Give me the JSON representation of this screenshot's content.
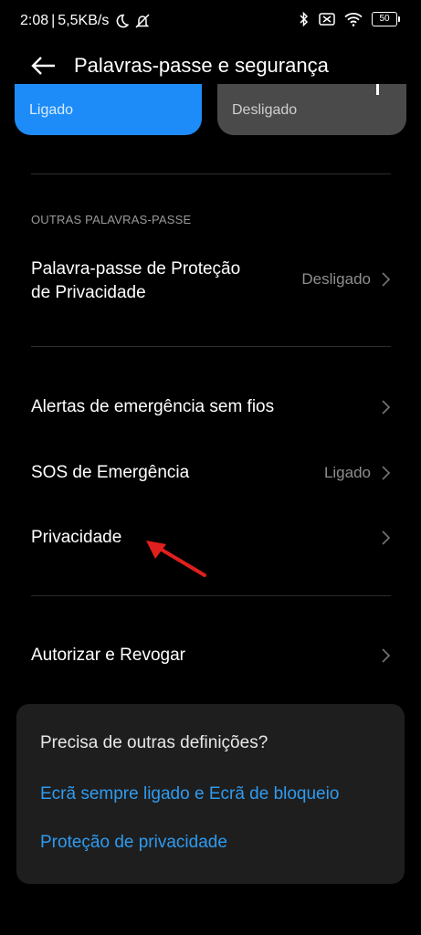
{
  "status_bar": {
    "time": "2:08",
    "separator": "|",
    "speed": "5,5KB/s",
    "battery": "50",
    "icons": [
      "moon-icon",
      "bell-off-icon",
      "bluetooth-icon",
      "screen-icon",
      "wifi-icon",
      "battery-icon"
    ]
  },
  "header": {
    "title": "Palavras-passe e segurança",
    "back_icon": "arrow-left-icon"
  },
  "modes": {
    "on_label": "Ligado",
    "off_label": "Desligado"
  },
  "section": {
    "header": "OUTRAS PALAVRAS-PASSE"
  },
  "rows": {
    "privacy_password": {
      "title_line1": "Palavra-passe de Proteção",
      "title_line2": "de Privacidade",
      "value": "Desligado"
    },
    "emergency_alerts": {
      "title": "Alertas de emergência sem fios"
    },
    "sos": {
      "title": "SOS de Emergência",
      "value": "Ligado"
    },
    "privacy": {
      "title": "Privacidade"
    },
    "authorize": {
      "title": "Autorizar e Revogar"
    }
  },
  "suggestions": {
    "title": "Precisa de outras definições?",
    "links": [
      "Ecrã sempre ligado e Ecrã de bloqueio",
      "Proteção de privacidade"
    ]
  },
  "colors": {
    "background": "#000000",
    "accent": "#1d8cf8",
    "link": "#2e9bf0",
    "annotation_arrow": "#e0201e"
  }
}
